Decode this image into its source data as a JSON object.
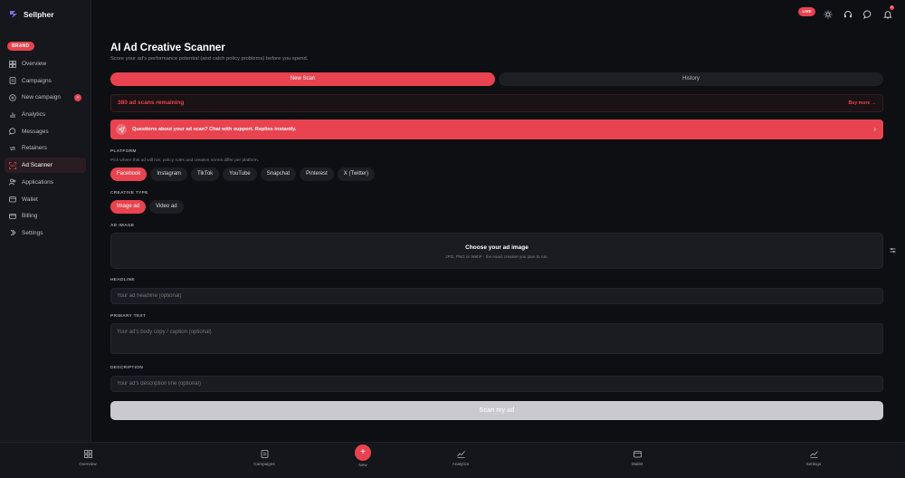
{
  "app": {
    "name": "Sellpher",
    "role_badge": "BRAND"
  },
  "sidebar": {
    "items": [
      {
        "label": "Overview",
        "icon": "grid-icon"
      },
      {
        "label": "Campaigns",
        "icon": "document-icon"
      },
      {
        "label": "New campaign",
        "icon": "plus-circle-icon",
        "badge": "+"
      },
      {
        "label": "Analytics",
        "icon": "bar-chart-icon"
      },
      {
        "label": "Messages",
        "icon": "chat-icon"
      },
      {
        "label": "Retainers",
        "icon": "repeat-icon"
      },
      {
        "label": "Ad Scanner",
        "icon": "scan-icon",
        "active": true
      },
      {
        "label": "Applications",
        "icon": "users-icon"
      },
      {
        "label": "Wallet",
        "icon": "wallet-icon"
      },
      {
        "label": "Billing",
        "icon": "card-icon"
      },
      {
        "label": "Settings",
        "icon": "settings-icon"
      }
    ]
  },
  "topbar": {
    "live_label": "LIVE",
    "notification_count": "3"
  },
  "page": {
    "title": "AI Ad Creative Scanner",
    "subtitle": "Score your ad's performance potential (and catch policy problems) before you spend."
  },
  "tabs": {
    "new_scan": "New Scan",
    "history": "History"
  },
  "scans": {
    "remaining": "380 ad scans remaining",
    "buy_more": "Buy more →"
  },
  "support": {
    "text": "Questions about your ad scan? Chat with support. Replies instantly.",
    "chevron": "›"
  },
  "platform": {
    "label": "PLATFORM",
    "hint": "Pick where this ad will run; policy rules and creative norms differ per platform.",
    "options": [
      "Facebook",
      "Instagram",
      "TikTok",
      "YouTube",
      "Snapchat",
      "Pinterest",
      "X (Twitter)"
    ],
    "selected": "Facebook"
  },
  "creative_type": {
    "label": "CREATIVE TYPE",
    "options": [
      "Image ad",
      "Video ad"
    ],
    "selected": "Image ad"
  },
  "ad_image": {
    "label": "AD IMAGE",
    "title": "Choose your ad image",
    "subtitle": "JPG, PNG or WebP · the exact creative you plan to run."
  },
  "headline": {
    "label": "HEADLINE",
    "placeholder": "Your ad headline (optional)"
  },
  "primary_text": {
    "label": "PRIMARY TEXT",
    "placeholder": "Your ad's body copy / caption (optional)"
  },
  "description": {
    "label": "DESCRIPTION",
    "placeholder": "Your ad's description line (optional)"
  },
  "scan_button": "Scan my ad",
  "bottom_nav": {
    "overview": "Overview",
    "campaigns": "Campaigns",
    "new": "New",
    "analytics": "Analytics",
    "wallet": "Wallet",
    "settings": "Settings"
  },
  "colors": {
    "accent": "#e8434f",
    "background": "#0e0f13",
    "surface": "#1b1c22"
  }
}
